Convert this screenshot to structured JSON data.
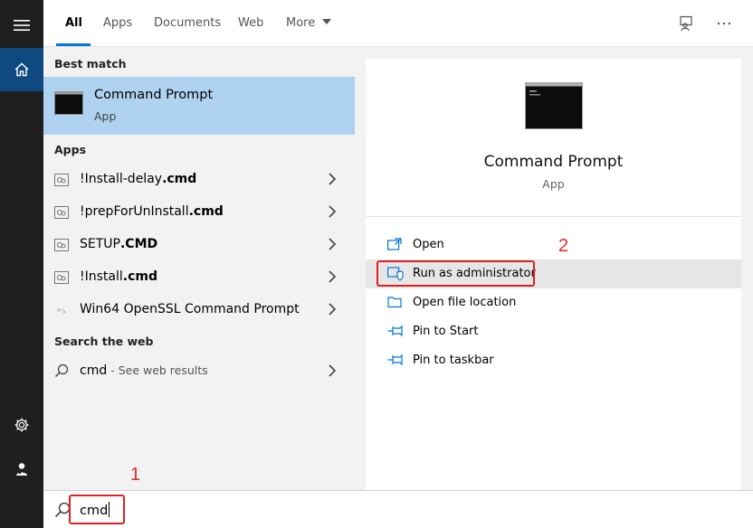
{
  "tabs": [
    {
      "label": "All",
      "active": true
    },
    {
      "label": "Apps"
    },
    {
      "label": "Documents"
    },
    {
      "label": "Web"
    },
    {
      "label": "More"
    }
  ],
  "results": {
    "best_match_header": "Best match",
    "best_match": {
      "title": "Command Prompt",
      "subtitle": "App"
    },
    "apps_header": "Apps",
    "apps": [
      {
        "name": "!Install-delay",
        "ext": ".cmd"
      },
      {
        "name": "!prepForUnInstall",
        "ext": ".cmd"
      },
      {
        "name": "SETUP",
        "ext": ".CMD"
      },
      {
        "name": "!Install",
        "ext": ".cmd"
      },
      {
        "name": "Win64 OpenSSL Command Prompt",
        "ext": ""
      }
    ],
    "web_header": "Search the web",
    "web": {
      "query": "cmd",
      "hint": " - See web results"
    }
  },
  "detail": {
    "title": "Command Prompt",
    "subtitle": "App",
    "actions": [
      {
        "label": "Open",
        "icon": "open-window-icon"
      },
      {
        "label": "Run as administrator",
        "icon": "admin-shield-icon",
        "highlighted": true
      },
      {
        "label": "Open file location",
        "icon": "file-location-icon"
      },
      {
        "label": "Pin to Start",
        "icon": "pin-icon"
      },
      {
        "label": "Pin to taskbar",
        "icon": "pin-icon"
      }
    ]
  },
  "search": {
    "value": "cmd"
  },
  "annotations": {
    "step1": "1",
    "step2": "2"
  },
  "colors": {
    "accent": "#0078d7",
    "selection": "#aed2f0",
    "annotation": "#e02020",
    "rail": "#1f1f1f"
  }
}
